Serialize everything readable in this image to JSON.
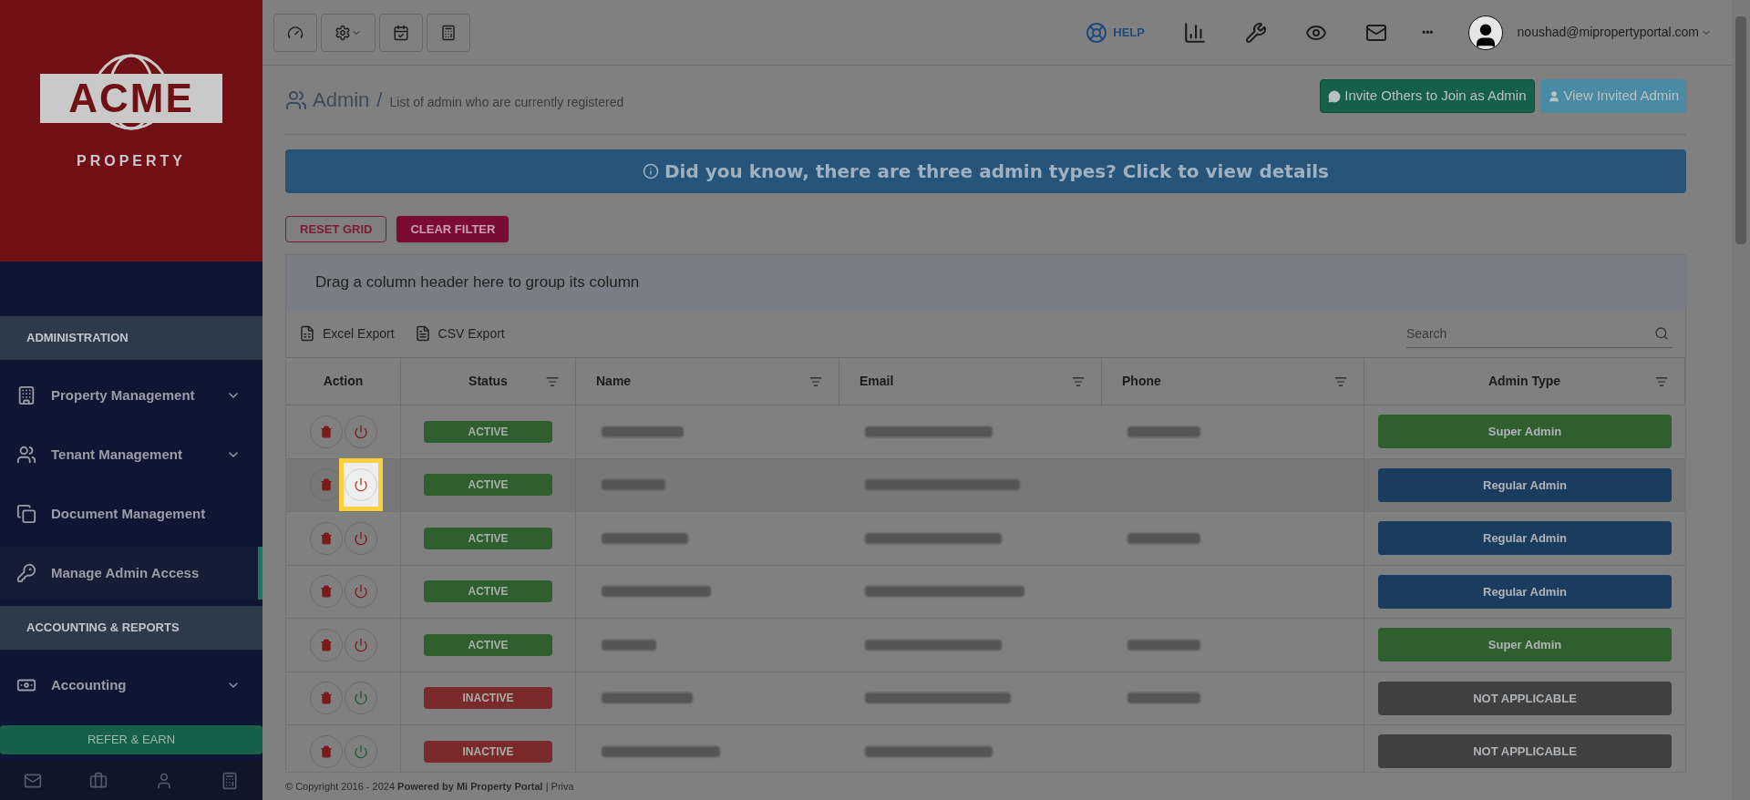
{
  "logo": {
    "word": "ACME",
    "sub": "PROPERTY"
  },
  "sidebar": {
    "sections": [
      {
        "title": "ADMINISTRATION",
        "items": [
          {
            "label": "Property Management",
            "expandable": true,
            "selected": false
          },
          {
            "label": "Tenant Management",
            "expandable": true,
            "selected": false
          },
          {
            "label": "Document Management",
            "expandable": false,
            "selected": false
          },
          {
            "label": "Manage Admin Access",
            "expandable": false,
            "selected": true
          }
        ]
      },
      {
        "title": "ACCOUNTING & REPORTS",
        "items": [
          {
            "label": "Accounting",
            "expandable": true,
            "selected": false
          }
        ]
      }
    ],
    "refer_button": "REFER & EARN"
  },
  "topbar": {
    "help": "HELP",
    "more": "•••",
    "user_email": "noushad@mipropertyportal.com"
  },
  "page": {
    "title": "Admin",
    "separator": "/",
    "subtitle": "List of admin who are currently registered",
    "actions": [
      "Invite Others to Join as Admin",
      "View Invited Admin"
    ]
  },
  "banner": "Did you know, there are three admin types? Click to view details",
  "grid_buttons": [
    "RESET GRID",
    "CLEAR FILTER"
  ],
  "group_hint": "Drag a column header here to group its column",
  "exports": [
    "Excel Export",
    "CSV Export"
  ],
  "search": {
    "placeholder": "Search"
  },
  "columns": [
    {
      "label": "Action",
      "filter": false,
      "centered": true
    },
    {
      "label": "Status",
      "filter": true,
      "centered": true
    },
    {
      "label": "Name",
      "filter": true,
      "centered": false
    },
    {
      "label": "Email",
      "filter": true,
      "centered": false
    },
    {
      "label": "Phone",
      "filter": true,
      "centered": false
    },
    {
      "label": "Admin Type",
      "filter": true,
      "centered": true
    }
  ],
  "rows": [
    {
      "status": "ACTIVE",
      "active": true,
      "admin_type": "Super Admin",
      "color": "#2f5e2f",
      "phone_shown": true,
      "focused": false
    },
    {
      "status": "ACTIVE",
      "active": true,
      "admin_type": "Regular Admin",
      "color": "#1a3c5e",
      "phone_shown": false,
      "focused": true
    },
    {
      "status": "ACTIVE",
      "active": true,
      "admin_type": "Regular Admin",
      "color": "#1a3c5e",
      "phone_shown": true,
      "focused": false
    },
    {
      "status": "ACTIVE",
      "active": true,
      "admin_type": "Regular Admin",
      "color": "#1a3c5e",
      "phone_shown": false,
      "focused": false
    },
    {
      "status": "ACTIVE",
      "active": true,
      "admin_type": "Super Admin",
      "color": "#2f5e2f",
      "phone_shown": true,
      "focused": false
    },
    {
      "status": "INACTIVE",
      "active": false,
      "admin_type": "NOT APPLICABLE",
      "color": "#404040",
      "phone_shown": true,
      "focused": false
    },
    {
      "status": "INACTIVE",
      "active": false,
      "admin_type": "NOT APPLICABLE",
      "color": "#404040",
      "phone_shown": false,
      "focused": false
    }
  ],
  "footer": "© Copyright 2016 - 2024 **Powered by Mi Property Portal** | Priva"
}
